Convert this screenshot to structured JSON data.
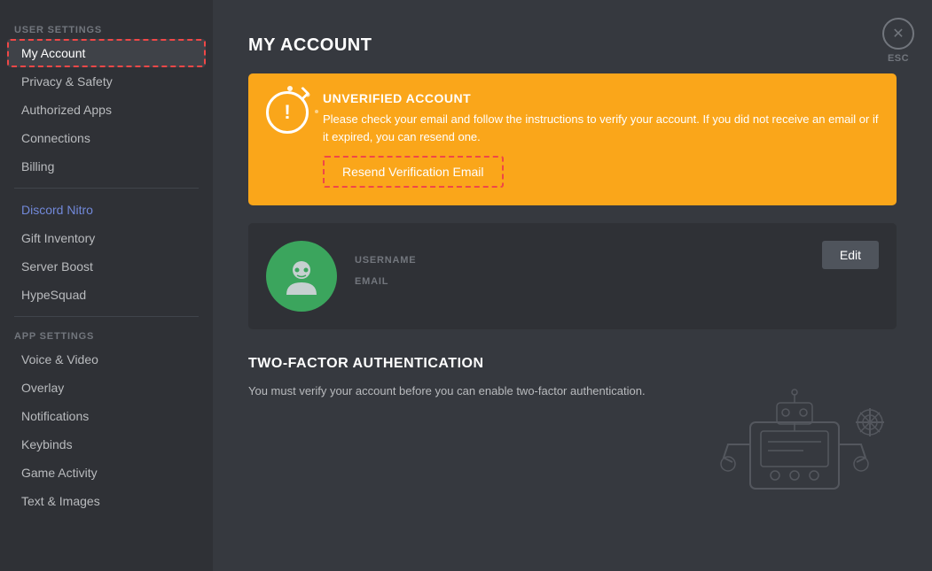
{
  "sidebar": {
    "user_settings_label": "USER SETTINGS",
    "app_settings_label": "APP SETTINGS",
    "items": {
      "my_account": "My Account",
      "privacy_safety": "Privacy & Safety",
      "authorized_apps": "Authorized Apps",
      "connections": "Connections",
      "billing": "Billing",
      "discord_nitro": "Discord Nitro",
      "gift_inventory": "Gift Inventory",
      "server_boost": "Server Boost",
      "hypesquad": "HypeSquad",
      "voice_video": "Voice & Video",
      "overlay": "Overlay",
      "notifications": "Notifications",
      "keybinds": "Keybinds",
      "game_activity": "Game Activity",
      "text_images": "Text & Images"
    }
  },
  "main": {
    "page_title": "MY ACCOUNT",
    "banner": {
      "title": "UNVERIFIED ACCOUNT",
      "description": "Please check your email and follow the instructions to verify your account. If you did not receive an email or if it expired, you can resend one.",
      "button_label": "Resend Verification Email"
    },
    "account": {
      "username_label": "USERNAME",
      "email_label": "EMAIL",
      "edit_label": "Edit"
    },
    "tfa": {
      "section_title": "TWO-FACTOR AUTHENTICATION",
      "description": "You must verify your account before you can enable two-factor authentication."
    },
    "esc": {
      "label": "ESC"
    }
  }
}
